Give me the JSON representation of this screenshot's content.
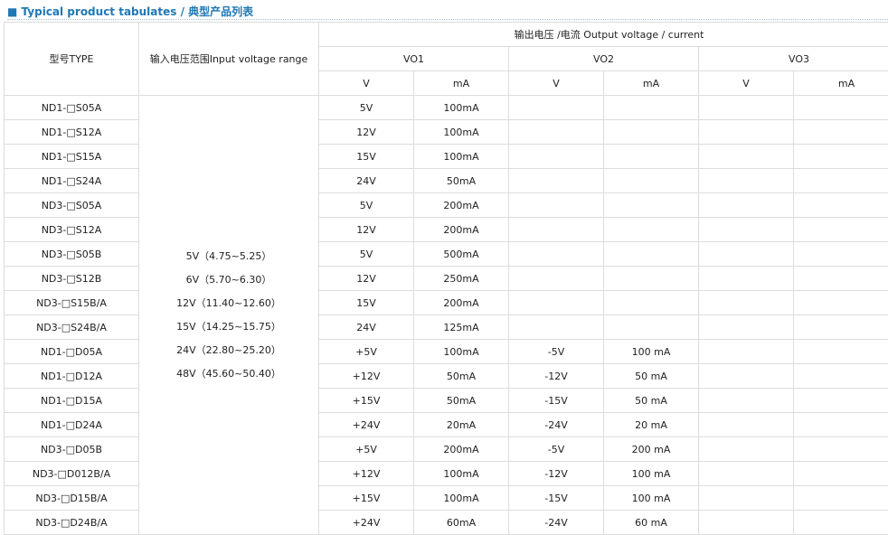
{
  "page": {
    "title": "■ Typical product tabulates / 典型产品列表"
  },
  "table": {
    "headers": {
      "type": "型号TYPE",
      "input": "输入电压范围Input voltage range",
      "output": "输出电压  /电流  Output voltage / current",
      "vo1": "VO1",
      "vo2": "VO2",
      "vo3": "VO3",
      "v": "V",
      "ma": "mA"
    },
    "input_ranges": [
      "5V（4.75~5.25）",
      "6V（5.70~6.30）",
      "12V（11.40~12.60）",
      "15V（14.25~15.75）",
      "24V（22.80~25.20）",
      "48V（45.60~50.40）"
    ],
    "rows": [
      {
        "type": "ND1-□S05A",
        "vo1_v": "5V",
        "vo1_ma": "100mA",
        "vo2_v": "",
        "vo2_ma": "",
        "vo3_v": "",
        "vo3_ma": ""
      },
      {
        "type": "ND1-□S12A",
        "vo1_v": "12V",
        "vo1_ma": "100mA",
        "vo2_v": "",
        "vo2_ma": "",
        "vo3_v": "",
        "vo3_ma": ""
      },
      {
        "type": "ND1-□S15A",
        "vo1_v": "15V",
        "vo1_ma": "100mA",
        "vo2_v": "",
        "vo2_ma": "",
        "vo3_v": "",
        "vo3_ma": ""
      },
      {
        "type": "ND1-□S24A",
        "vo1_v": "24V",
        "vo1_ma": "50mA",
        "vo2_v": "",
        "vo2_ma": "",
        "vo3_v": "",
        "vo3_ma": ""
      },
      {
        "type": "ND3-□S05A",
        "vo1_v": "5V",
        "vo1_ma": "200mA",
        "vo2_v": "",
        "vo2_ma": "",
        "vo3_v": "",
        "vo3_ma": ""
      },
      {
        "type": "ND3-□S12A",
        "vo1_v": "12V",
        "vo1_ma": "200mA",
        "vo2_v": "",
        "vo2_ma": "",
        "vo3_v": "",
        "vo3_ma": ""
      },
      {
        "type": "ND3-□S05B",
        "vo1_v": "5V",
        "vo1_ma": "500mA",
        "vo2_v": "",
        "vo2_ma": "",
        "vo3_v": "",
        "vo3_ma": ""
      },
      {
        "type": "ND3-□S12B",
        "vo1_v": "12V",
        "vo1_ma": "250mA",
        "vo2_v": "",
        "vo2_ma": "",
        "vo3_v": "",
        "vo3_ma": ""
      },
      {
        "type": "ND3-□S15B/A",
        "vo1_v": "15V",
        "vo1_ma": "200mA",
        "vo2_v": "",
        "vo2_ma": "",
        "vo3_v": "",
        "vo3_ma": ""
      },
      {
        "type": "ND3-□S24B/A",
        "vo1_v": "24V",
        "vo1_ma": "125mA",
        "vo2_v": "",
        "vo2_ma": "",
        "vo3_v": "",
        "vo3_ma": ""
      },
      {
        "type": "ND1-□D05A",
        "vo1_v": "+5V",
        "vo1_ma": "100mA",
        "vo2_v": "-5V",
        "vo2_ma": "100 mA",
        "vo3_v": "",
        "vo3_ma": ""
      },
      {
        "type": "ND1-□D12A",
        "vo1_v": "+12V",
        "vo1_ma": "50mA",
        "vo2_v": "-12V",
        "vo2_ma": "50 mA",
        "vo3_v": "",
        "vo3_ma": ""
      },
      {
        "type": "ND1-□D15A",
        "vo1_v": "+15V",
        "vo1_ma": "50mA",
        "vo2_v": "-15V",
        "vo2_ma": "50 mA",
        "vo3_v": "",
        "vo3_ma": ""
      },
      {
        "type": "ND1-□D24A",
        "vo1_v": "+24V",
        "vo1_ma": "20mA",
        "vo2_v": "-24V",
        "vo2_ma": "20 mA",
        "vo3_v": "",
        "vo3_ma": ""
      },
      {
        "type": "ND3-□D05B",
        "vo1_v": "+5V",
        "vo1_ma": "200mA",
        "vo2_v": "-5V",
        "vo2_ma": "200 mA",
        "vo3_v": "",
        "vo3_ma": ""
      },
      {
        "type": "ND3-□D012B/A",
        "vo1_v": "+12V",
        "vo1_ma": "100mA",
        "vo2_v": "-12V",
        "vo2_ma": "100 mA",
        "vo3_v": "",
        "vo3_ma": ""
      },
      {
        "type": "ND3-□D15B/A",
        "vo1_v": "+15V",
        "vo1_ma": "100mA",
        "vo2_v": "-15V",
        "vo2_ma": "100 mA",
        "vo3_v": "",
        "vo3_ma": ""
      },
      {
        "type": "ND3-□D24B/A",
        "vo1_v": "+24V",
        "vo1_ma": "60mA",
        "vo2_v": "-24V",
        "vo2_ma": "60 mA",
        "vo3_v": "",
        "vo3_ma": ""
      }
    ]
  }
}
